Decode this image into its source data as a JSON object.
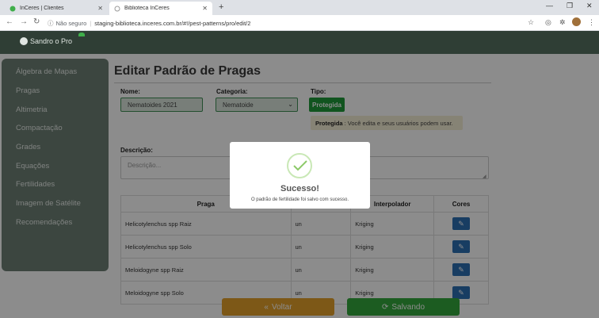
{
  "browser": {
    "tabs": [
      {
        "title": "InCeres | Clientes"
      },
      {
        "title": "Biblioteca InCeres"
      }
    ],
    "security_label": "Não seguro",
    "url": "staging-biblioteca.inceres.com.br/#!/pest-patterns/pro/edit/2"
  },
  "header": {
    "user_name": "Sandro o Pro"
  },
  "sidebar": {
    "items": [
      {
        "label": "Álgebra de Mapas"
      },
      {
        "label": "Pragas"
      },
      {
        "label": "Altimetria"
      },
      {
        "label": "Compactação"
      },
      {
        "label": "Grades"
      },
      {
        "label": "Equações"
      },
      {
        "label": "Fertilidades"
      },
      {
        "label": "Imagem de Satélite"
      },
      {
        "label": "Recomendações"
      }
    ]
  },
  "page": {
    "title": "Editar Padrão de Pragas"
  },
  "form": {
    "nome_label": "Nome:",
    "nome_value": "Nematoides 2021",
    "categoria_label": "Categoria:",
    "categoria_value": "Nematoide",
    "tipo_label": "Tipo:",
    "tipo_value": "Protegida",
    "tip_title": "Protegida",
    "tip_text": ": Você edita e seus usuários podem usar.",
    "descricao_label": "Descrição:",
    "descricao_placeholder": "Descrição..."
  },
  "table": {
    "headers": [
      "Praga",
      "",
      "Interpolador",
      "Cores"
    ],
    "rows": [
      {
        "praga": "Helicotylenchus spp Raiz",
        "unidade": "un",
        "interpolador": "Kriging"
      },
      {
        "praga": "Helicotylenchus spp Solo",
        "unidade": "un",
        "interpolador": "Kriging"
      },
      {
        "praga": "Meloidogyne spp Raiz",
        "unidade": "un",
        "interpolador": "Kriging"
      },
      {
        "praga": "Meloidogyne spp Solo",
        "unidade": "un",
        "interpolador": "Kriging"
      }
    ]
  },
  "footer": {
    "back_label": "Voltar",
    "save_label": "Salvando"
  },
  "modal": {
    "title": "Sucesso!",
    "message": "O padrão de fertilidade foi salvo com sucesso."
  },
  "colors": {
    "header_bg": "#2f3e35",
    "sidebar_bg": "#6d8075",
    "accent_green": "#1f9a3a",
    "button_blue": "#2d6fb3",
    "voltar_orange": "#e3a02a"
  }
}
